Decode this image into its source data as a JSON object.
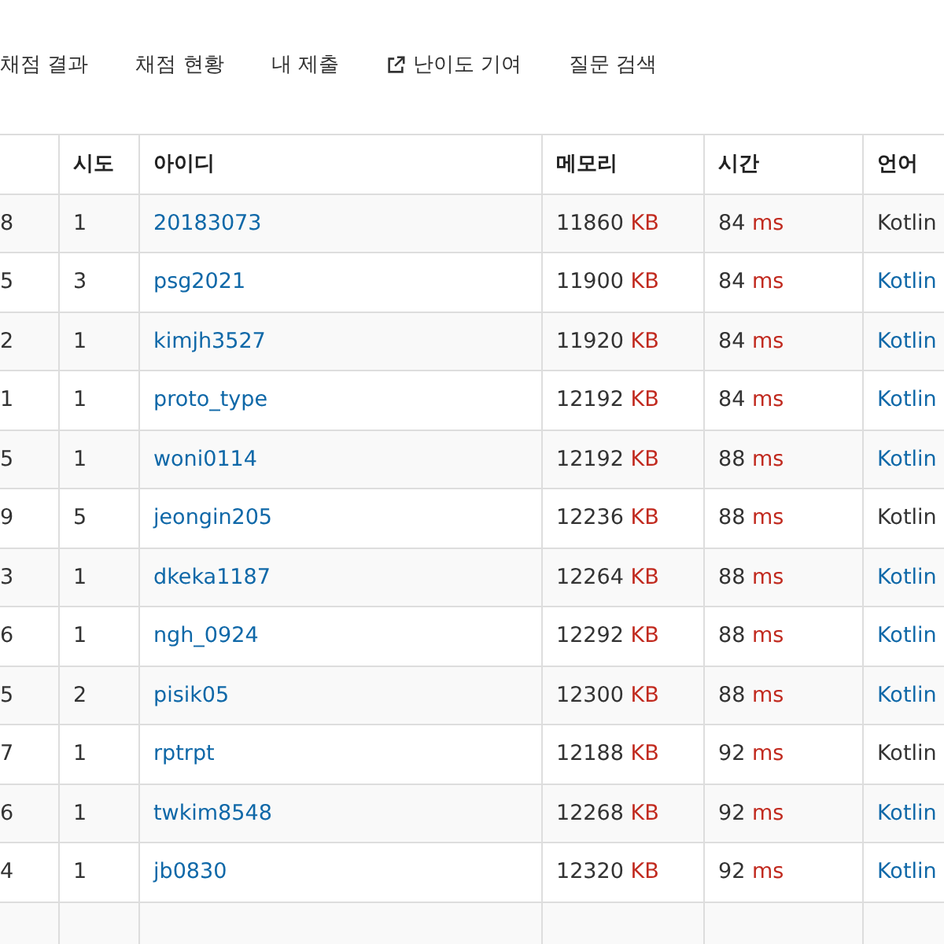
{
  "nav": [
    {
      "label": "채점 결과",
      "external": false
    },
    {
      "label": "채점 현황",
      "external": false
    },
    {
      "label": "내 제출",
      "external": false
    },
    {
      "label": "난이도 기여",
      "external": true
    },
    {
      "label": "질문 검색",
      "external": false
    }
  ],
  "table": {
    "columns": [
      "시도",
      "아이디",
      "메모리",
      "시간",
      "언어"
    ],
    "rows": [
      {
        "rank": "8",
        "tries": "1",
        "user": "20183073",
        "memory": "11860",
        "memory_unit": "KB",
        "time": "84",
        "time_unit": "ms",
        "language": "Kotlin",
        "language_linked": false
      },
      {
        "rank": "5",
        "tries": "3",
        "user": "psg2021",
        "memory": "11900",
        "memory_unit": "KB",
        "time": "84",
        "time_unit": "ms",
        "language": "Kotlin",
        "language_linked": true
      },
      {
        "rank": "2",
        "tries": "1",
        "user": "kimjh3527",
        "memory": "11920",
        "memory_unit": "KB",
        "time": "84",
        "time_unit": "ms",
        "language": "Kotlin",
        "language_linked": true
      },
      {
        "rank": "1",
        "tries": "1",
        "user": "proto_type",
        "memory": "12192",
        "memory_unit": "KB",
        "time": "84",
        "time_unit": "ms",
        "language": "Kotlin",
        "language_linked": true
      },
      {
        "rank": "5",
        "tries": "1",
        "user": "woni0114",
        "memory": "12192",
        "memory_unit": "KB",
        "time": "88",
        "time_unit": "ms",
        "language": "Kotlin",
        "language_linked": true
      },
      {
        "rank": "9",
        "tries": "5",
        "user": "jeongin205",
        "memory": "12236",
        "memory_unit": "KB",
        "time": "88",
        "time_unit": "ms",
        "language": "Kotlin",
        "language_linked": false
      },
      {
        "rank": "3",
        "tries": "1",
        "user": "dkeka1187",
        "memory": "12264",
        "memory_unit": "KB",
        "time": "88",
        "time_unit": "ms",
        "language": "Kotlin",
        "language_linked": true
      },
      {
        "rank": "6",
        "tries": "1",
        "user": "ngh_0924",
        "memory": "12292",
        "memory_unit": "KB",
        "time": "88",
        "time_unit": "ms",
        "language": "Kotlin",
        "language_linked": true
      },
      {
        "rank": "5",
        "tries": "2",
        "user": "pisik05",
        "memory": "12300",
        "memory_unit": "KB",
        "time": "88",
        "time_unit": "ms",
        "language": "Kotlin",
        "language_linked": true
      },
      {
        "rank": "7",
        "tries": "1",
        "user": "rptrpt",
        "memory": "12188",
        "memory_unit": "KB",
        "time": "92",
        "time_unit": "ms",
        "language": "Kotlin",
        "language_linked": false
      },
      {
        "rank": "6",
        "tries": "1",
        "user": "twkim8548",
        "memory": "12268",
        "memory_unit": "KB",
        "time": "92",
        "time_unit": "ms",
        "language": "Kotlin",
        "language_linked": true
      },
      {
        "rank": "4",
        "tries": "1",
        "user": "jb0830",
        "memory": "12320",
        "memory_unit": "KB",
        "time": "92",
        "time_unit": "ms",
        "language": "Kotlin",
        "language_linked": true
      }
    ]
  }
}
